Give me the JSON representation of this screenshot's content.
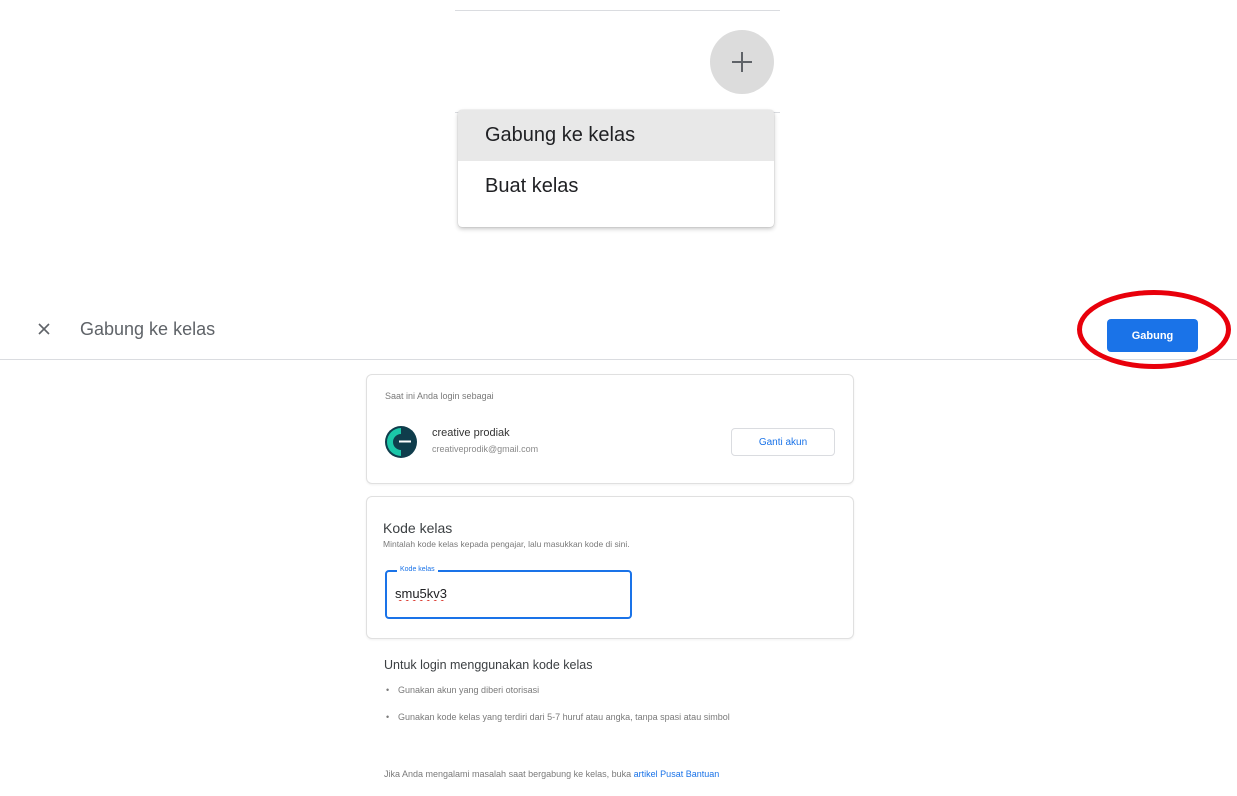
{
  "menu": {
    "items": [
      {
        "label": "Gabung ke kelas",
        "active": true
      },
      {
        "label": "Buat kelas",
        "active": false
      }
    ]
  },
  "header": {
    "title": "Gabung ke kelas",
    "join_label": "Gabung"
  },
  "account": {
    "label": "Saat ini Anda login sebagai",
    "name": "creative prodiak",
    "email": "creativeprodik@gmail.com",
    "switch_label": "Ganti akun"
  },
  "class_code": {
    "title": "Kode kelas",
    "description": "Mintalah kode kelas kepada pengajar, lalu masukkan kode di sini.",
    "field_label": "Kode kelas",
    "value": "smu5kv3"
  },
  "instructions": {
    "title": "Untuk login menggunakan kode kelas",
    "items": [
      "Gunakan akun yang diberi otorisasi",
      "Gunakan kode kelas yang terdiri dari 5-7 huruf atau angka, tanpa spasi atau simbol"
    ],
    "help_prefix": "Jika Anda mengalami masalah saat bergabung ke kelas, buka",
    "help_link": "artikel Pusat Bantuan"
  },
  "colors": {
    "primary": "#1a73e8",
    "annotation": "#e8000b",
    "menu_active_bg": "#e8e8e8"
  }
}
